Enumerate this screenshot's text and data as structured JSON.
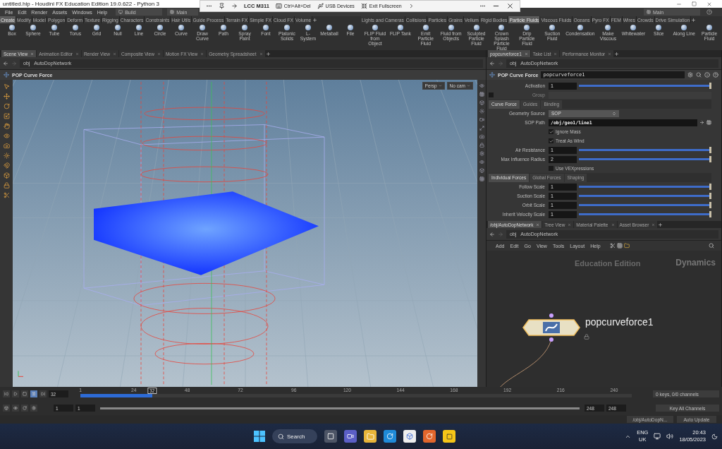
{
  "window": {
    "title": "untitled.hip - Houdini FX Education Edition 19.0.622 - Python 3"
  },
  "remote_toolbar": {
    "name": "LCC M311",
    "items": [
      {
        "kind": "keyboard",
        "label": "Ctrl+Alt+Del"
      },
      {
        "kind": "usb",
        "label": "USB Devices"
      },
      {
        "kind": "fullscreen",
        "label": "Exit Fullscreen"
      }
    ]
  },
  "menu": [
    "File",
    "Edit",
    "Render",
    "Assets",
    "Windows",
    "Help"
  ],
  "desktop": "Build",
  "left_desk": "Main",
  "right_desk": "Main",
  "shelf_left": {
    "tabs": [
      {
        "label": "Create",
        "selected": true
      },
      {
        "label": "Modify",
        "selected": false
      },
      {
        "label": "Model",
        "selected": false
      },
      {
        "label": "Polygon",
        "selected": false
      },
      {
        "label": "Deform",
        "selected": false
      },
      {
        "label": "Texture",
        "selected": false
      },
      {
        "label": "Rigging",
        "selected": false
      },
      {
        "label": "Characters",
        "selected": false
      },
      {
        "label": "Constraints",
        "selected": false
      },
      {
        "label": "Hair Utils",
        "selected": false
      },
      {
        "label": "Guide Process",
        "selected": false
      },
      {
        "label": "Terrain FX",
        "selected": false
      },
      {
        "label": "Simple FX",
        "selected": false
      },
      {
        "label": "Cloud FX",
        "selected": false
      },
      {
        "label": "Volume",
        "selected": false
      }
    ],
    "tools": [
      "Box",
      "Sphere",
      "Tube",
      "Torus",
      "Grid",
      "Null",
      "Line",
      "Circle",
      "Curve",
      "Draw Curve",
      "Path",
      "Spray Paint",
      "Font",
      "Platonic Solids",
      "L-System",
      "Metaball",
      "File"
    ]
  },
  "shelf_right": {
    "tabs": [
      {
        "label": "Lights and Cameras",
        "selected": false
      },
      {
        "label": "Collisions",
        "selected": false
      },
      {
        "label": "Particles",
        "selected": false
      },
      {
        "label": "Grains",
        "selected": false
      },
      {
        "label": "Vellum",
        "selected": false
      },
      {
        "label": "Rigid Bodies",
        "selected": false
      },
      {
        "label": "Particle Fluids",
        "selected": true
      },
      {
        "label": "Viscous Fluids",
        "selected": false
      },
      {
        "label": "Oceans",
        "selected": false
      },
      {
        "label": "Pyro FX",
        "selected": false
      },
      {
        "label": "FEM",
        "selected": false
      },
      {
        "label": "Wires",
        "selected": false
      },
      {
        "label": "Crowds",
        "selected": false
      },
      {
        "label": "Drive Simulation",
        "selected": false
      }
    ],
    "tools": [
      "FLIP Fluid from Object",
      "FLIP Tank",
      "Emit Particle Fluid",
      "Fluid from Objects",
      "Sculpted Particle Fluid",
      "Crown Splash Particle Fluid",
      "Drip Particle Fluid",
      "Suction Fluid",
      "Condensation",
      "Make Viscous",
      "Whitewater",
      "Slice",
      "Along Line",
      "Particle Fluid"
    ]
  },
  "scene_pane": {
    "tabs": [
      {
        "label": "Scene View",
        "selected": true
      },
      {
        "label": "Animation Editor",
        "selected": false
      },
      {
        "label": "Render View",
        "selected": false
      },
      {
        "label": "Composite View",
        "selected": false
      },
      {
        "label": "Motion FX View",
        "selected": false
      },
      {
        "label": "Geometry Spreadsheet",
        "selected": false
      }
    ],
    "path": [
      "obj",
      "AutoDopNetwork"
    ],
    "node_type": "POP Curve Force",
    "camera": "Persp",
    "cam_menu": "No cam"
  },
  "param_pane": {
    "tabs": [
      {
        "label": "popcurveforce1",
        "selected": true
      },
      {
        "label": "Take List",
        "selected": false
      },
      {
        "label": "Performance Monitor",
        "selected": false
      }
    ],
    "path": [
      "obj",
      "AutoDopNetwork"
    ],
    "node_type": "POP Curve Force",
    "node_name": "popcurveforce1",
    "rows": [
      {
        "kind": "slider",
        "label": "Activation",
        "value": "1",
        "level": 1
      },
      {
        "kind": "group",
        "label": "Group",
        "checked": false,
        "disabled": true
      },
      {
        "kind": "tabs",
        "tabs": [
          {
            "label": "Curve Force",
            "selected": true
          },
          {
            "label": "Guides",
            "selected": false
          },
          {
            "label": "Binding",
            "selected": false
          }
        ]
      },
      {
        "kind": "menu",
        "label": "Geometry Source",
        "value": "SOP"
      },
      {
        "kind": "path",
        "label": "SOP Path",
        "value": "/obj/geo1/line1"
      },
      {
        "kind": "checkbox",
        "label": "Ignore Mass",
        "checked": true
      },
      {
        "kind": "checkbox",
        "label": "Treat As Wind",
        "checked": true
      },
      {
        "kind": "slider",
        "label": "Air Resistance",
        "value": "1",
        "level": 1
      },
      {
        "kind": "slider",
        "label": "Max Influence Radius",
        "value": "2",
        "level": 1
      },
      {
        "kind": "checkbox",
        "label": "Use VEXpressions",
        "checked": false
      },
      {
        "kind": "tabs",
        "tabs": [
          {
            "label": "Individual Forces",
            "selected": true
          },
          {
            "label": "Global Forces",
            "selected": false
          },
          {
            "label": "Shaping",
            "selected": false
          }
        ]
      },
      {
        "kind": "slider",
        "label": "Follow Scale",
        "value": "1",
        "level": 1
      },
      {
        "kind": "slider",
        "label": "Suction Scale",
        "value": "1",
        "level": 1
      },
      {
        "kind": "slider",
        "label": "Orbit Scale",
        "value": "1",
        "level": 1
      },
      {
        "kind": "slider",
        "label": "Inherit Velocity Scale",
        "value": "1",
        "level": 1
      }
    ]
  },
  "network_pane": {
    "tabs": [
      {
        "label": "/obj/AutoDopNetwork",
        "selected": true
      },
      {
        "label": "Tree View",
        "selected": false
      },
      {
        "label": "Material Palette",
        "selected": false
      },
      {
        "label": "Asset Browser",
        "selected": false
      }
    ],
    "path": [
      "obj",
      "AutoDopNetwork"
    ],
    "menu": [
      "Add",
      "Edit",
      "Go",
      "View",
      "Tools",
      "Layout",
      "Help"
    ],
    "watermark": "Education Edition",
    "context": "Dynamics",
    "node": {
      "name": "popcurveforce1"
    }
  },
  "timeline": {
    "frame_field": "32",
    "frame_marker": "32",
    "level": 0.13,
    "ticks": [
      "1",
      "24",
      "48",
      "72",
      "96",
      "120",
      "144",
      "168",
      "192",
      "216",
      "240"
    ],
    "range_bar": {
      "level": 1
    },
    "start": "1",
    "start2": "1",
    "end": "248",
    "end2": "248",
    "keys": "0 keys, 0/0 channels",
    "key_button": "Key All Channels"
  },
  "status": {
    "path": "/obj/AutoDopN...",
    "update": "Auto Update"
  },
  "taskbar": {
    "search": "Search",
    "lang": "ENG",
    "region": "UK",
    "time": "20:43",
    "date": "18/05/2023"
  }
}
